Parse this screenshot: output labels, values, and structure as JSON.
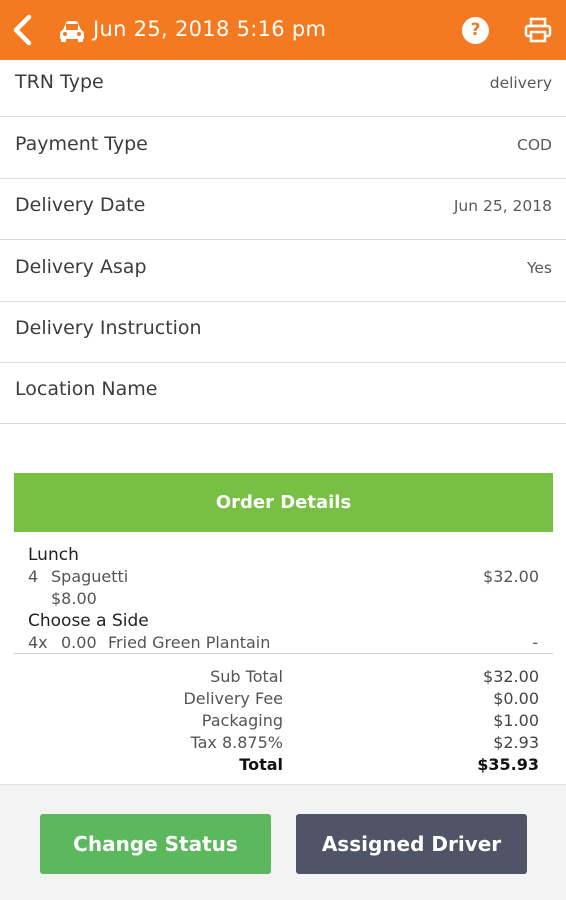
{
  "header": {
    "title": "Jun 25, 2018 5:16 pm",
    "help_symbol": "?",
    "accent_color": "#f37a20",
    "icons": [
      "back-arrow-icon",
      "car-icon",
      "help-icon",
      "printer-icon"
    ]
  },
  "info_rows": [
    {
      "label": "TRN Type",
      "value": "delivery"
    },
    {
      "label": "Payment Type",
      "value": "COD"
    },
    {
      "label": "Delivery Date",
      "value": "Jun 25, 2018"
    },
    {
      "label": "Delivery Asap",
      "value": "Yes"
    },
    {
      "label": "Delivery Instruction",
      "value": ""
    },
    {
      "label": "Location Name",
      "value": ""
    }
  ],
  "order": {
    "header_label": "Order Details",
    "header_color": "#78c043",
    "category": "Lunch",
    "item": {
      "qty": "4",
      "name": "Spaguetti",
      "price": "$32.00",
      "unit_price": "$8.00"
    },
    "option_group": "Choose a Side",
    "option": {
      "qty": "4x",
      "price": "0.00",
      "name": "Fried Green Plantain",
      "total": "-"
    }
  },
  "summary": {
    "rows": [
      {
        "label": "Sub Total",
        "value": "$32.00"
      },
      {
        "label": "Delivery Fee",
        "value": "$0.00"
      },
      {
        "label": "Packaging",
        "value": "$1.00"
      },
      {
        "label": "Tax 8.875%",
        "value": "$2.93"
      },
      {
        "label": "Total",
        "value": "$35.93"
      }
    ]
  },
  "actions": {
    "change_status": "Change Status",
    "assigned_driver": "Assigned Driver"
  }
}
